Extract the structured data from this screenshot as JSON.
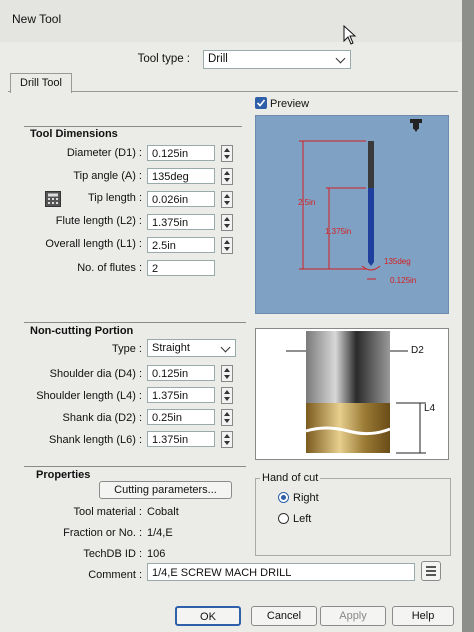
{
  "window": {
    "title": "New Tool"
  },
  "tool_type": {
    "label": "Tool type :",
    "value": "Drill"
  },
  "tab": {
    "label": "Drill Tool"
  },
  "preview": {
    "label": "Preview",
    "checked": true
  },
  "tool_dimensions": {
    "title": "Tool Dimensions",
    "fields": [
      {
        "label": "Diameter (D1) :",
        "value": "0.125in"
      },
      {
        "label": "Tip angle (A) :",
        "value": "135deg"
      },
      {
        "label": "Tip length :",
        "value": "0.026in"
      },
      {
        "label": "Flute length (L2) :",
        "value": "1.375in"
      },
      {
        "label": "Overall length (L1) :",
        "value": "2.5in"
      },
      {
        "label": "No. of flutes :",
        "value": "2"
      }
    ]
  },
  "preview_labels": {
    "overall": "2.5in",
    "flute": "1.375in",
    "angle": "135deg",
    "dia": "0.125in"
  },
  "non_cutting": {
    "title": "Non-cutting Portion",
    "type_label": "Type :",
    "type_value": "Straight",
    "fields": [
      {
        "label": "Shoulder dia (D4) :",
        "value": "0.125in"
      },
      {
        "label": "Shoulder length (L4) :",
        "value": "1.375in"
      },
      {
        "label": "Shank dia (D2) :",
        "value": "0.25in"
      },
      {
        "label": "Shank length (L6) :",
        "value": "1.375in"
      }
    ],
    "diagram_labels": {
      "d2": "D2",
      "l4": "L4"
    }
  },
  "properties": {
    "title": "Properties",
    "cutting_button": "Cutting parameters...",
    "tool_material_label": "Tool material :",
    "tool_material": "Cobalt",
    "fraction_label": "Fraction or No. :",
    "fraction": "1/4,E",
    "techdb_label": "TechDB ID :",
    "techdb": "106",
    "comment_label": "Comment :",
    "comment": "1/4,E SCREW MACH DRILL"
  },
  "hand_of_cut": {
    "title": "Hand of cut",
    "right": "Right",
    "left": "Left",
    "selected": "Right"
  },
  "buttons": {
    "ok": "OK",
    "cancel": "Cancel",
    "apply": "Apply",
    "help": "Help"
  },
  "colors": {
    "preview_bg": "#7fa1c4",
    "accent": "#2e5fa8",
    "annotation": "#d32020"
  }
}
